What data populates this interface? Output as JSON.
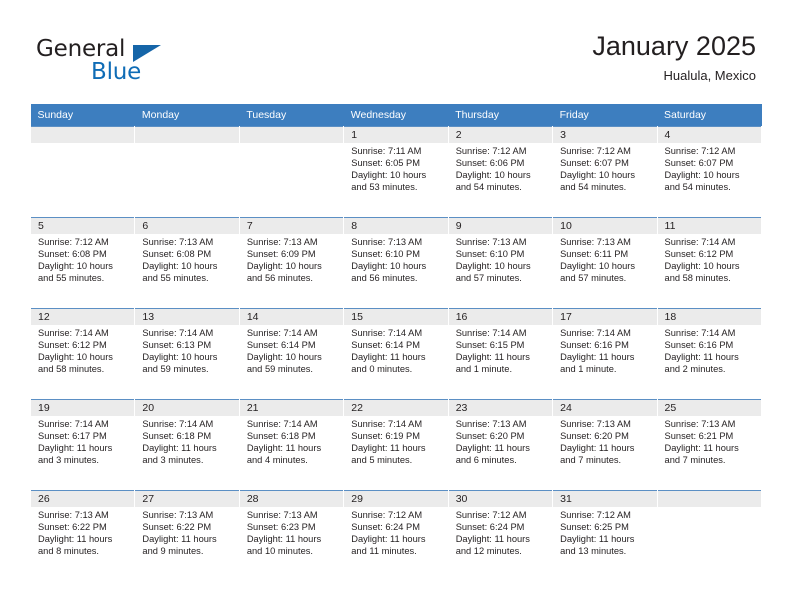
{
  "brand": {
    "name_part1": "General",
    "name_part2": "Blue",
    "triangle_color": "#1565a8",
    "blue_color": "#0f6cb6"
  },
  "header": {
    "title": "January 2025",
    "subtitle": "Hualula, Mexico"
  },
  "colors": {
    "header_row_bg": "#3d7ebf",
    "header_row_text": "#ffffff",
    "daynum_bg": "#ebebeb",
    "text": "#231f20"
  },
  "weekday_headers": [
    "Sunday",
    "Monday",
    "Tuesday",
    "Wednesday",
    "Thursday",
    "Friday",
    "Saturday"
  ],
  "weeks": [
    [
      {
        "day": "",
        "empty": true,
        "sunrise": "",
        "sunset": "",
        "daylight_line1": "",
        "daylight_line2": ""
      },
      {
        "day": "",
        "empty": true,
        "sunrise": "",
        "sunset": "",
        "daylight_line1": "",
        "daylight_line2": ""
      },
      {
        "day": "",
        "empty": true,
        "sunrise": "",
        "sunset": "",
        "daylight_line1": "",
        "daylight_line2": ""
      },
      {
        "day": "1",
        "empty": false,
        "sunrise": "Sunrise: 7:11 AM",
        "sunset": "Sunset: 6:05 PM",
        "daylight_line1": "Daylight: 10 hours",
        "daylight_line2": "and 53 minutes."
      },
      {
        "day": "2",
        "empty": false,
        "sunrise": "Sunrise: 7:12 AM",
        "sunset": "Sunset: 6:06 PM",
        "daylight_line1": "Daylight: 10 hours",
        "daylight_line2": "and 54 minutes."
      },
      {
        "day": "3",
        "empty": false,
        "sunrise": "Sunrise: 7:12 AM",
        "sunset": "Sunset: 6:07 PM",
        "daylight_line1": "Daylight: 10 hours",
        "daylight_line2": "and 54 minutes."
      },
      {
        "day": "4",
        "empty": false,
        "sunrise": "Sunrise: 7:12 AM",
        "sunset": "Sunset: 6:07 PM",
        "daylight_line1": "Daylight: 10 hours",
        "daylight_line2": "and 54 minutes."
      }
    ],
    [
      {
        "day": "5",
        "empty": false,
        "sunrise": "Sunrise: 7:12 AM",
        "sunset": "Sunset: 6:08 PM",
        "daylight_line1": "Daylight: 10 hours",
        "daylight_line2": "and 55 minutes."
      },
      {
        "day": "6",
        "empty": false,
        "sunrise": "Sunrise: 7:13 AM",
        "sunset": "Sunset: 6:08 PM",
        "daylight_line1": "Daylight: 10 hours",
        "daylight_line2": "and 55 minutes."
      },
      {
        "day": "7",
        "empty": false,
        "sunrise": "Sunrise: 7:13 AM",
        "sunset": "Sunset: 6:09 PM",
        "daylight_line1": "Daylight: 10 hours",
        "daylight_line2": "and 56 minutes."
      },
      {
        "day": "8",
        "empty": false,
        "sunrise": "Sunrise: 7:13 AM",
        "sunset": "Sunset: 6:10 PM",
        "daylight_line1": "Daylight: 10 hours",
        "daylight_line2": "and 56 minutes."
      },
      {
        "day": "9",
        "empty": false,
        "sunrise": "Sunrise: 7:13 AM",
        "sunset": "Sunset: 6:10 PM",
        "daylight_line1": "Daylight: 10 hours",
        "daylight_line2": "and 57 minutes."
      },
      {
        "day": "10",
        "empty": false,
        "sunrise": "Sunrise: 7:13 AM",
        "sunset": "Sunset: 6:11 PM",
        "daylight_line1": "Daylight: 10 hours",
        "daylight_line2": "and 57 minutes."
      },
      {
        "day": "11",
        "empty": false,
        "sunrise": "Sunrise: 7:14 AM",
        "sunset": "Sunset: 6:12 PM",
        "daylight_line1": "Daylight: 10 hours",
        "daylight_line2": "and 58 minutes."
      }
    ],
    [
      {
        "day": "12",
        "empty": false,
        "sunrise": "Sunrise: 7:14 AM",
        "sunset": "Sunset: 6:12 PM",
        "daylight_line1": "Daylight: 10 hours",
        "daylight_line2": "and 58 minutes."
      },
      {
        "day": "13",
        "empty": false,
        "sunrise": "Sunrise: 7:14 AM",
        "sunset": "Sunset: 6:13 PM",
        "daylight_line1": "Daylight: 10 hours",
        "daylight_line2": "and 59 minutes."
      },
      {
        "day": "14",
        "empty": false,
        "sunrise": "Sunrise: 7:14 AM",
        "sunset": "Sunset: 6:14 PM",
        "daylight_line1": "Daylight: 10 hours",
        "daylight_line2": "and 59 minutes."
      },
      {
        "day": "15",
        "empty": false,
        "sunrise": "Sunrise: 7:14 AM",
        "sunset": "Sunset: 6:14 PM",
        "daylight_line1": "Daylight: 11 hours",
        "daylight_line2": "and 0 minutes."
      },
      {
        "day": "16",
        "empty": false,
        "sunrise": "Sunrise: 7:14 AM",
        "sunset": "Sunset: 6:15 PM",
        "daylight_line1": "Daylight: 11 hours",
        "daylight_line2": "and 1 minute."
      },
      {
        "day": "17",
        "empty": false,
        "sunrise": "Sunrise: 7:14 AM",
        "sunset": "Sunset: 6:16 PM",
        "daylight_line1": "Daylight: 11 hours",
        "daylight_line2": "and 1 minute."
      },
      {
        "day": "18",
        "empty": false,
        "sunrise": "Sunrise: 7:14 AM",
        "sunset": "Sunset: 6:16 PM",
        "daylight_line1": "Daylight: 11 hours",
        "daylight_line2": "and 2 minutes."
      }
    ],
    [
      {
        "day": "19",
        "empty": false,
        "sunrise": "Sunrise: 7:14 AM",
        "sunset": "Sunset: 6:17 PM",
        "daylight_line1": "Daylight: 11 hours",
        "daylight_line2": "and 3 minutes."
      },
      {
        "day": "20",
        "empty": false,
        "sunrise": "Sunrise: 7:14 AM",
        "sunset": "Sunset: 6:18 PM",
        "daylight_line1": "Daylight: 11 hours",
        "daylight_line2": "and 3 minutes."
      },
      {
        "day": "21",
        "empty": false,
        "sunrise": "Sunrise: 7:14 AM",
        "sunset": "Sunset: 6:18 PM",
        "daylight_line1": "Daylight: 11 hours",
        "daylight_line2": "and 4 minutes."
      },
      {
        "day": "22",
        "empty": false,
        "sunrise": "Sunrise: 7:14 AM",
        "sunset": "Sunset: 6:19 PM",
        "daylight_line1": "Daylight: 11 hours",
        "daylight_line2": "and 5 minutes."
      },
      {
        "day": "23",
        "empty": false,
        "sunrise": "Sunrise: 7:13 AM",
        "sunset": "Sunset: 6:20 PM",
        "daylight_line1": "Daylight: 11 hours",
        "daylight_line2": "and 6 minutes."
      },
      {
        "day": "24",
        "empty": false,
        "sunrise": "Sunrise: 7:13 AM",
        "sunset": "Sunset: 6:20 PM",
        "daylight_line1": "Daylight: 11 hours",
        "daylight_line2": "and 7 minutes."
      },
      {
        "day": "25",
        "empty": false,
        "sunrise": "Sunrise: 7:13 AM",
        "sunset": "Sunset: 6:21 PM",
        "daylight_line1": "Daylight: 11 hours",
        "daylight_line2": "and 7 minutes."
      }
    ],
    [
      {
        "day": "26",
        "empty": false,
        "sunrise": "Sunrise: 7:13 AM",
        "sunset": "Sunset: 6:22 PM",
        "daylight_line1": "Daylight: 11 hours",
        "daylight_line2": "and 8 minutes."
      },
      {
        "day": "27",
        "empty": false,
        "sunrise": "Sunrise: 7:13 AM",
        "sunset": "Sunset: 6:22 PM",
        "daylight_line1": "Daylight: 11 hours",
        "daylight_line2": "and 9 minutes."
      },
      {
        "day": "28",
        "empty": false,
        "sunrise": "Sunrise: 7:13 AM",
        "sunset": "Sunset: 6:23 PM",
        "daylight_line1": "Daylight: 11 hours",
        "daylight_line2": "and 10 minutes."
      },
      {
        "day": "29",
        "empty": false,
        "sunrise": "Sunrise: 7:12 AM",
        "sunset": "Sunset: 6:24 PM",
        "daylight_line1": "Daylight: 11 hours",
        "daylight_line2": "and 11 minutes."
      },
      {
        "day": "30",
        "empty": false,
        "sunrise": "Sunrise: 7:12 AM",
        "sunset": "Sunset: 6:24 PM",
        "daylight_line1": "Daylight: 11 hours",
        "daylight_line2": "and 12 minutes."
      },
      {
        "day": "31",
        "empty": false,
        "sunrise": "Sunrise: 7:12 AM",
        "sunset": "Sunset: 6:25 PM",
        "daylight_line1": "Daylight: 11 hours",
        "daylight_line2": "and 13 minutes."
      },
      {
        "day": "",
        "empty": true,
        "sunrise": "",
        "sunset": "",
        "daylight_line1": "",
        "daylight_line2": ""
      }
    ]
  ]
}
